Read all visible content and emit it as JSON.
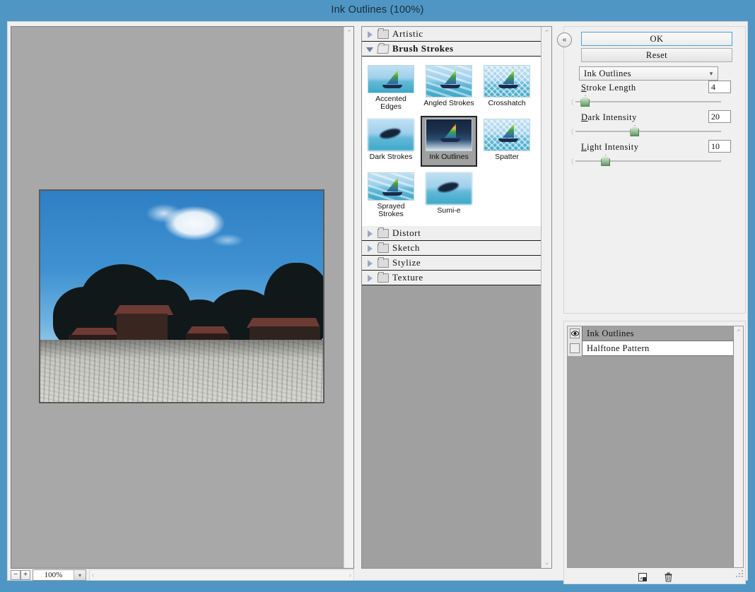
{
  "window": {
    "title": "Ink Outlines (100%)"
  },
  "preview": {
    "zoom_out_label": "−",
    "zoom_in_label": "+",
    "zoom_value": "100%",
    "zoom_dropdown_icon": "chevron-down-icon",
    "scroll_left_icon": "‹",
    "scroll_right_icon": "›",
    "image_description": "Ink Outlines filtered beach scene with palm trees and houses"
  },
  "gallery": {
    "scroll_up_icon": "⌃",
    "scroll_down_icon": "⌄",
    "categories": [
      {
        "label": "Artistic",
        "expanded": false
      },
      {
        "label": "Brush Strokes",
        "expanded": true
      },
      {
        "label": "Distort",
        "expanded": false
      },
      {
        "label": "Sketch",
        "expanded": false
      },
      {
        "label": "Stylize",
        "expanded": false
      },
      {
        "label": "Texture",
        "expanded": false
      }
    ],
    "brush_strokes_filters": [
      {
        "label": "Accented Edges",
        "selected": false,
        "style": "normal"
      },
      {
        "label": "Angled Strokes",
        "selected": false,
        "style": "streak"
      },
      {
        "label": "Crosshatch",
        "selected": false,
        "style": "hatch"
      },
      {
        "label": "Dark Strokes",
        "selected": false,
        "style": "soft"
      },
      {
        "label": "Ink Outlines",
        "selected": true,
        "style": "dark"
      },
      {
        "label": "Spatter",
        "selected": false,
        "style": "hatch"
      },
      {
        "label": "Sprayed Strokes",
        "selected": false,
        "style": "streak"
      },
      {
        "label": "Sumi-e",
        "selected": false,
        "style": "soft"
      }
    ]
  },
  "settings": {
    "collapse_icon": "«",
    "ok_label": "OK",
    "reset_label": "Reset",
    "filter_select": {
      "value": "Ink Outlines",
      "chevron": "⌄"
    },
    "controls": [
      {
        "name": "Stroke Length",
        "accel": "S",
        "rest": "troke Length",
        "value": "4",
        "min": 1,
        "max": 50,
        "percent": 6
      },
      {
        "name": "Dark Intensity",
        "accel": "D",
        "rest": "ark Intensity",
        "value": "20",
        "min": 0,
        "max": 50,
        "percent": 40
      },
      {
        "name": "Light Intensity",
        "accel": "L",
        "rest": "ight Intensity",
        "value": "10",
        "min": 0,
        "max": 50,
        "percent": 20
      }
    ]
  },
  "layers": {
    "items": [
      {
        "label": "Ink Outlines",
        "visible": true,
        "selected": true
      },
      {
        "label": "Halftone Pattern",
        "visible": false,
        "selected": false
      }
    ],
    "new_effect_layer_icon": "new-effect-layer-icon",
    "delete_layer_icon": "trash-icon",
    "scroll_up_icon": "⌃"
  },
  "colors": {
    "window_chrome": "#4f96c4",
    "dialog_bg": "#f0f0f0",
    "preview_bg": "#a8a8a8",
    "selection_gray": "#a0a0a0",
    "focus_blue": "#4a9fd8",
    "slider_green": "#5f9b63"
  }
}
